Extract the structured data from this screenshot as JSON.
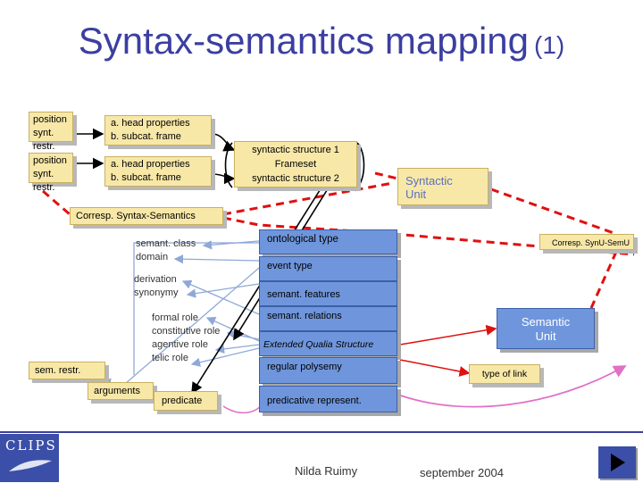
{
  "title": {
    "main": "Syntax-semantics mapping",
    "number": "(1)"
  },
  "syntax": {
    "pos1": [
      "position",
      "synt. restr."
    ],
    "pos2": [
      "position",
      "synt. restr."
    ],
    "head1": [
      "a. head properties",
      "b. subcat. frame"
    ],
    "head2": [
      "a. head properties",
      "b. subcat. frame"
    ],
    "structures": [
      "syntactic structure 1",
      "Frameset",
      "syntactic structure 2"
    ],
    "unit": [
      "Syntactic",
      "Unit"
    ]
  },
  "correspondence": {
    "syntax_semantics": "Corresp. Syntax-Semantics",
    "synu_semu": "Corresp. SynU-SemU"
  },
  "semantic_labels": {
    "group1": [
      "semant. class",
      "domain"
    ],
    "group2": [
      "derivation",
      "synonymy"
    ],
    "group3": [
      "formal role",
      "constitutive role",
      "agentive role",
      "telic role"
    ],
    "sem_restr": "sem. restr.",
    "arguments": "arguments",
    "predicate": "predicate"
  },
  "semantic_boxes": [
    "ontological type",
    "event type",
    "semant. features",
    "semant. relations",
    "Extended Qualia Structure",
    "regular polysemy",
    "predicative represent."
  ],
  "semantic_unit": [
    "Semantic",
    "Unit"
  ],
  "type_of_link": "type of link",
  "footer": {
    "author": "Nilda Ruimy",
    "date": "september 2004",
    "logo": "CLIPS"
  },
  "colors": {
    "title": "#3b3fa0",
    "semantic_box": "#6f96dc",
    "syntax_box": "#f8e8a8",
    "red_dash": "#e01010",
    "blue_arrow": "#8fa8d8",
    "pink_arrow": "#e070c8"
  }
}
